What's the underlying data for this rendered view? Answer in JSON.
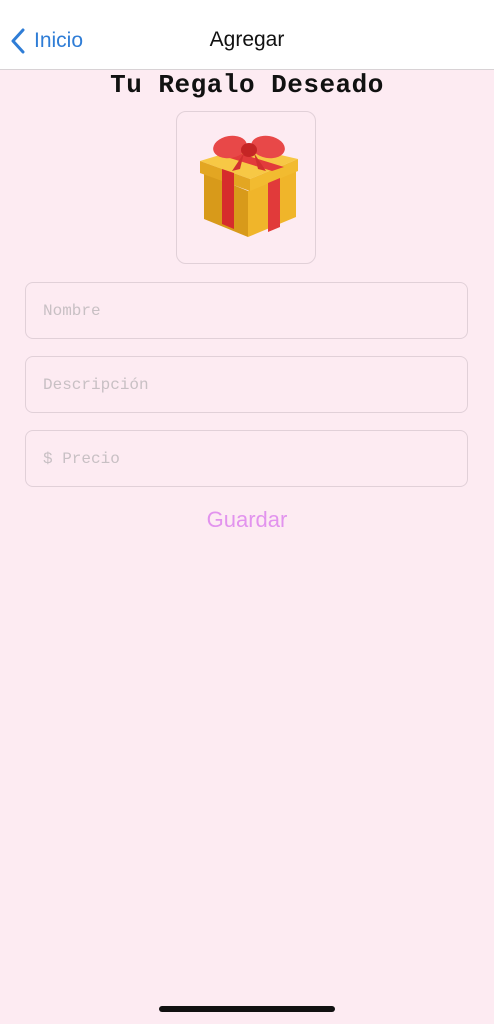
{
  "nav": {
    "back_label": "Inicio",
    "title": "Agregar"
  },
  "main": {
    "title": "Tu Regalo Deseado",
    "image_icon": "wrapped-gift-icon"
  },
  "form": {
    "name_placeholder": "Nombre",
    "description_placeholder": "Descripción",
    "price_placeholder": "$ Precio",
    "save_label": "Guardar"
  },
  "colors": {
    "background": "#fdebf2",
    "accent_link": "#2f7dd6",
    "save_button": "#e293ee",
    "field_border": "#e1d0d8"
  }
}
